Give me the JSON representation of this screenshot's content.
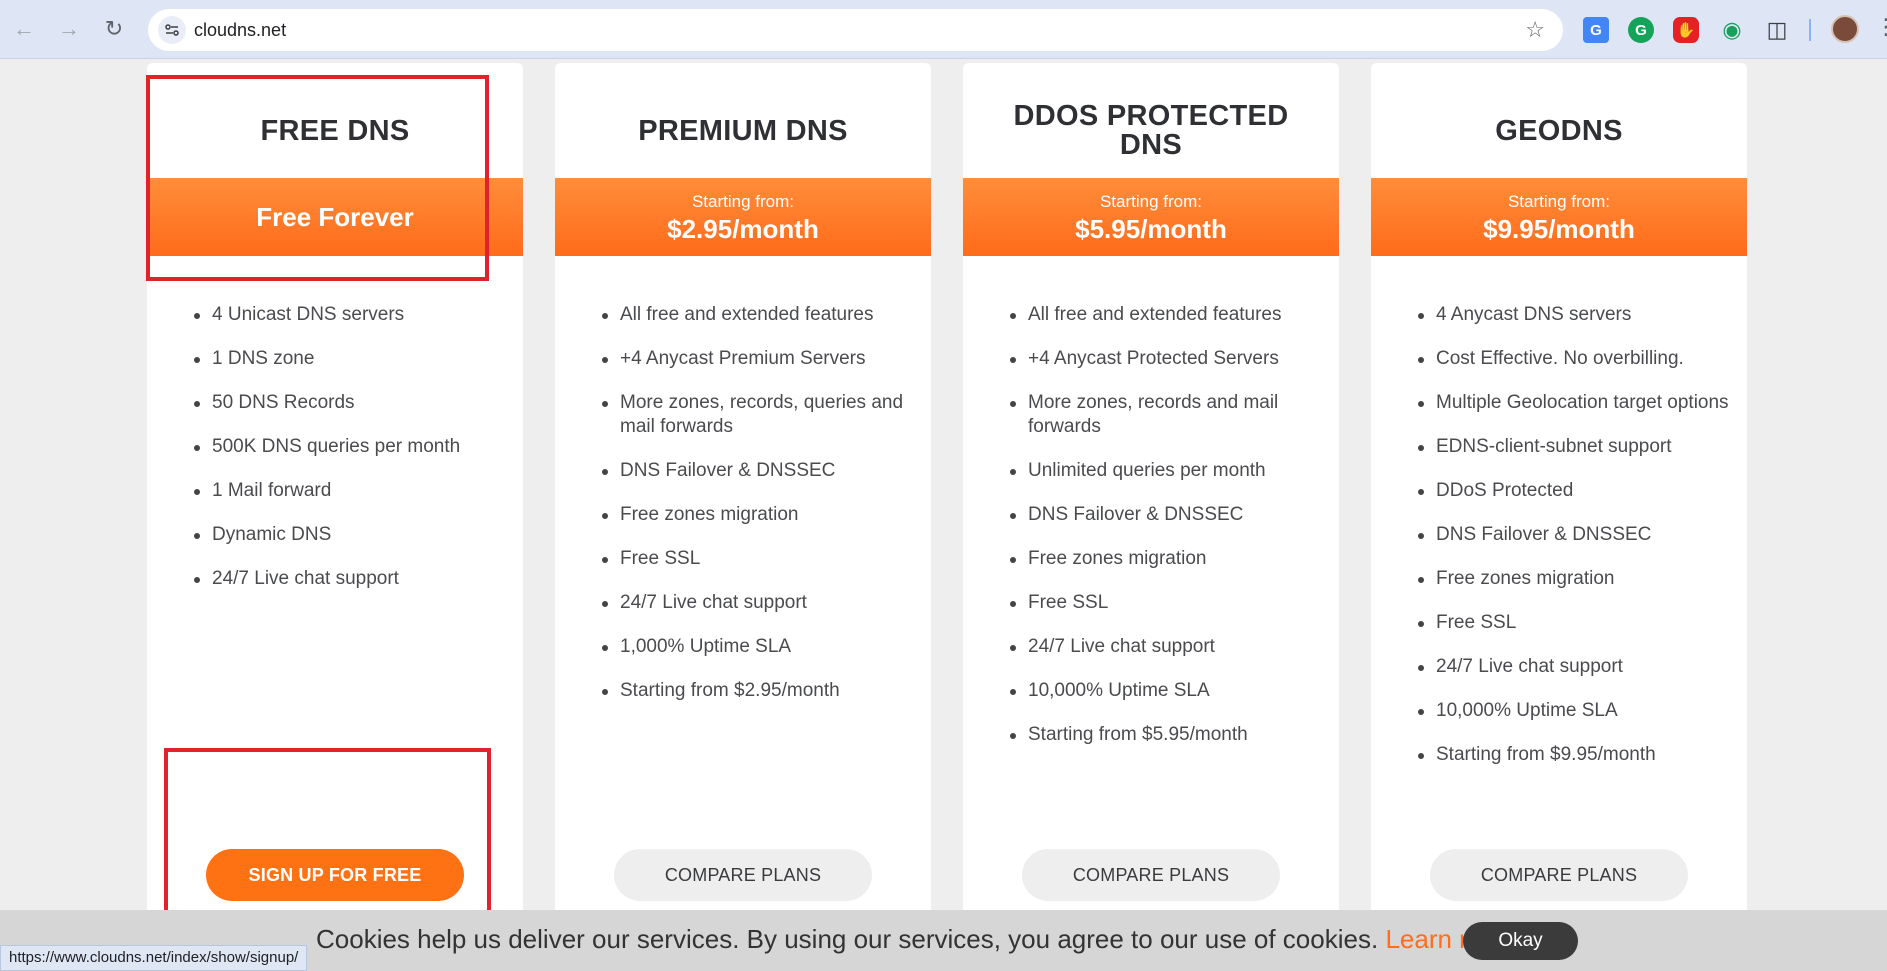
{
  "browser": {
    "url": "cloudns.net",
    "status_url": "https://www.cloudns.net/index/show/signup/",
    "icons": [
      "back-arrow-icon",
      "forward-arrow-icon",
      "reload-icon",
      "site-info-icon",
      "star-icon",
      "translate-icon",
      "grammarly-icon",
      "adblock-icon",
      "eye-icon",
      "puzzle-icon",
      "profile-avatar",
      "more-menu-icon"
    ]
  },
  "plans": [
    {
      "title": "FREE DNS",
      "price_label": "Free Forever",
      "features": [
        "4 Unicast DNS servers",
        "1 DNS zone",
        "50 DNS Records",
        "500K DNS queries per month",
        "1 Mail forward",
        "Dynamic DNS",
        "24/7 Live chat support"
      ],
      "button": "SIGN UP FOR FREE"
    },
    {
      "title": "PREMIUM DNS",
      "price_from": "Starting from:",
      "price": "$2.95/month",
      "features": [
        "All free and extended features",
        "+4 Anycast Premium Servers",
        "More zones, records, queries and mail forwards",
        "DNS Failover & DNSSEC",
        "Free zones migration",
        "Free SSL",
        "24/7 Live chat support",
        "1,000% Uptime SLA",
        "Starting from $2.95/month"
      ],
      "button": "COMPARE PLANS"
    },
    {
      "title": "DDOS PROTECTED DNS",
      "price_from": "Starting from:",
      "price": "$5.95/month",
      "features": [
        "All free and extended features",
        "+4 Anycast Protected Servers",
        "More zones, records and mail forwards",
        "Unlimited queries per month",
        "DNS Failover & DNSSEC",
        "Free zones migration",
        "Free SSL",
        "24/7 Live chat support",
        "10,000% Uptime SLA",
        "Starting from $5.95/month"
      ],
      "button": "COMPARE PLANS"
    },
    {
      "title": "GEODNS",
      "price_from": "Starting from:",
      "price": "$9.95/month",
      "features": [
        "4 Anycast DNS servers",
        "Cost Effective. No overbilling.",
        "Multiple Geolocation target options",
        "EDNS-client-subnet support",
        "DDoS Protected",
        "DNS Failover & DNSSEC",
        "Free zones migration",
        "Free SSL",
        "24/7 Live chat support",
        "10,000% Uptime SLA",
        "Starting from $9.95/month"
      ],
      "button": "COMPARE PLANS"
    }
  ],
  "cookie": {
    "text": "Cookies help us deliver our services. By using our services, you agree to our use of cookies.",
    "link": "Learn more",
    "button": "Okay"
  },
  "colors": {
    "accent": "#ff7214",
    "annotation": "#e0232a"
  }
}
